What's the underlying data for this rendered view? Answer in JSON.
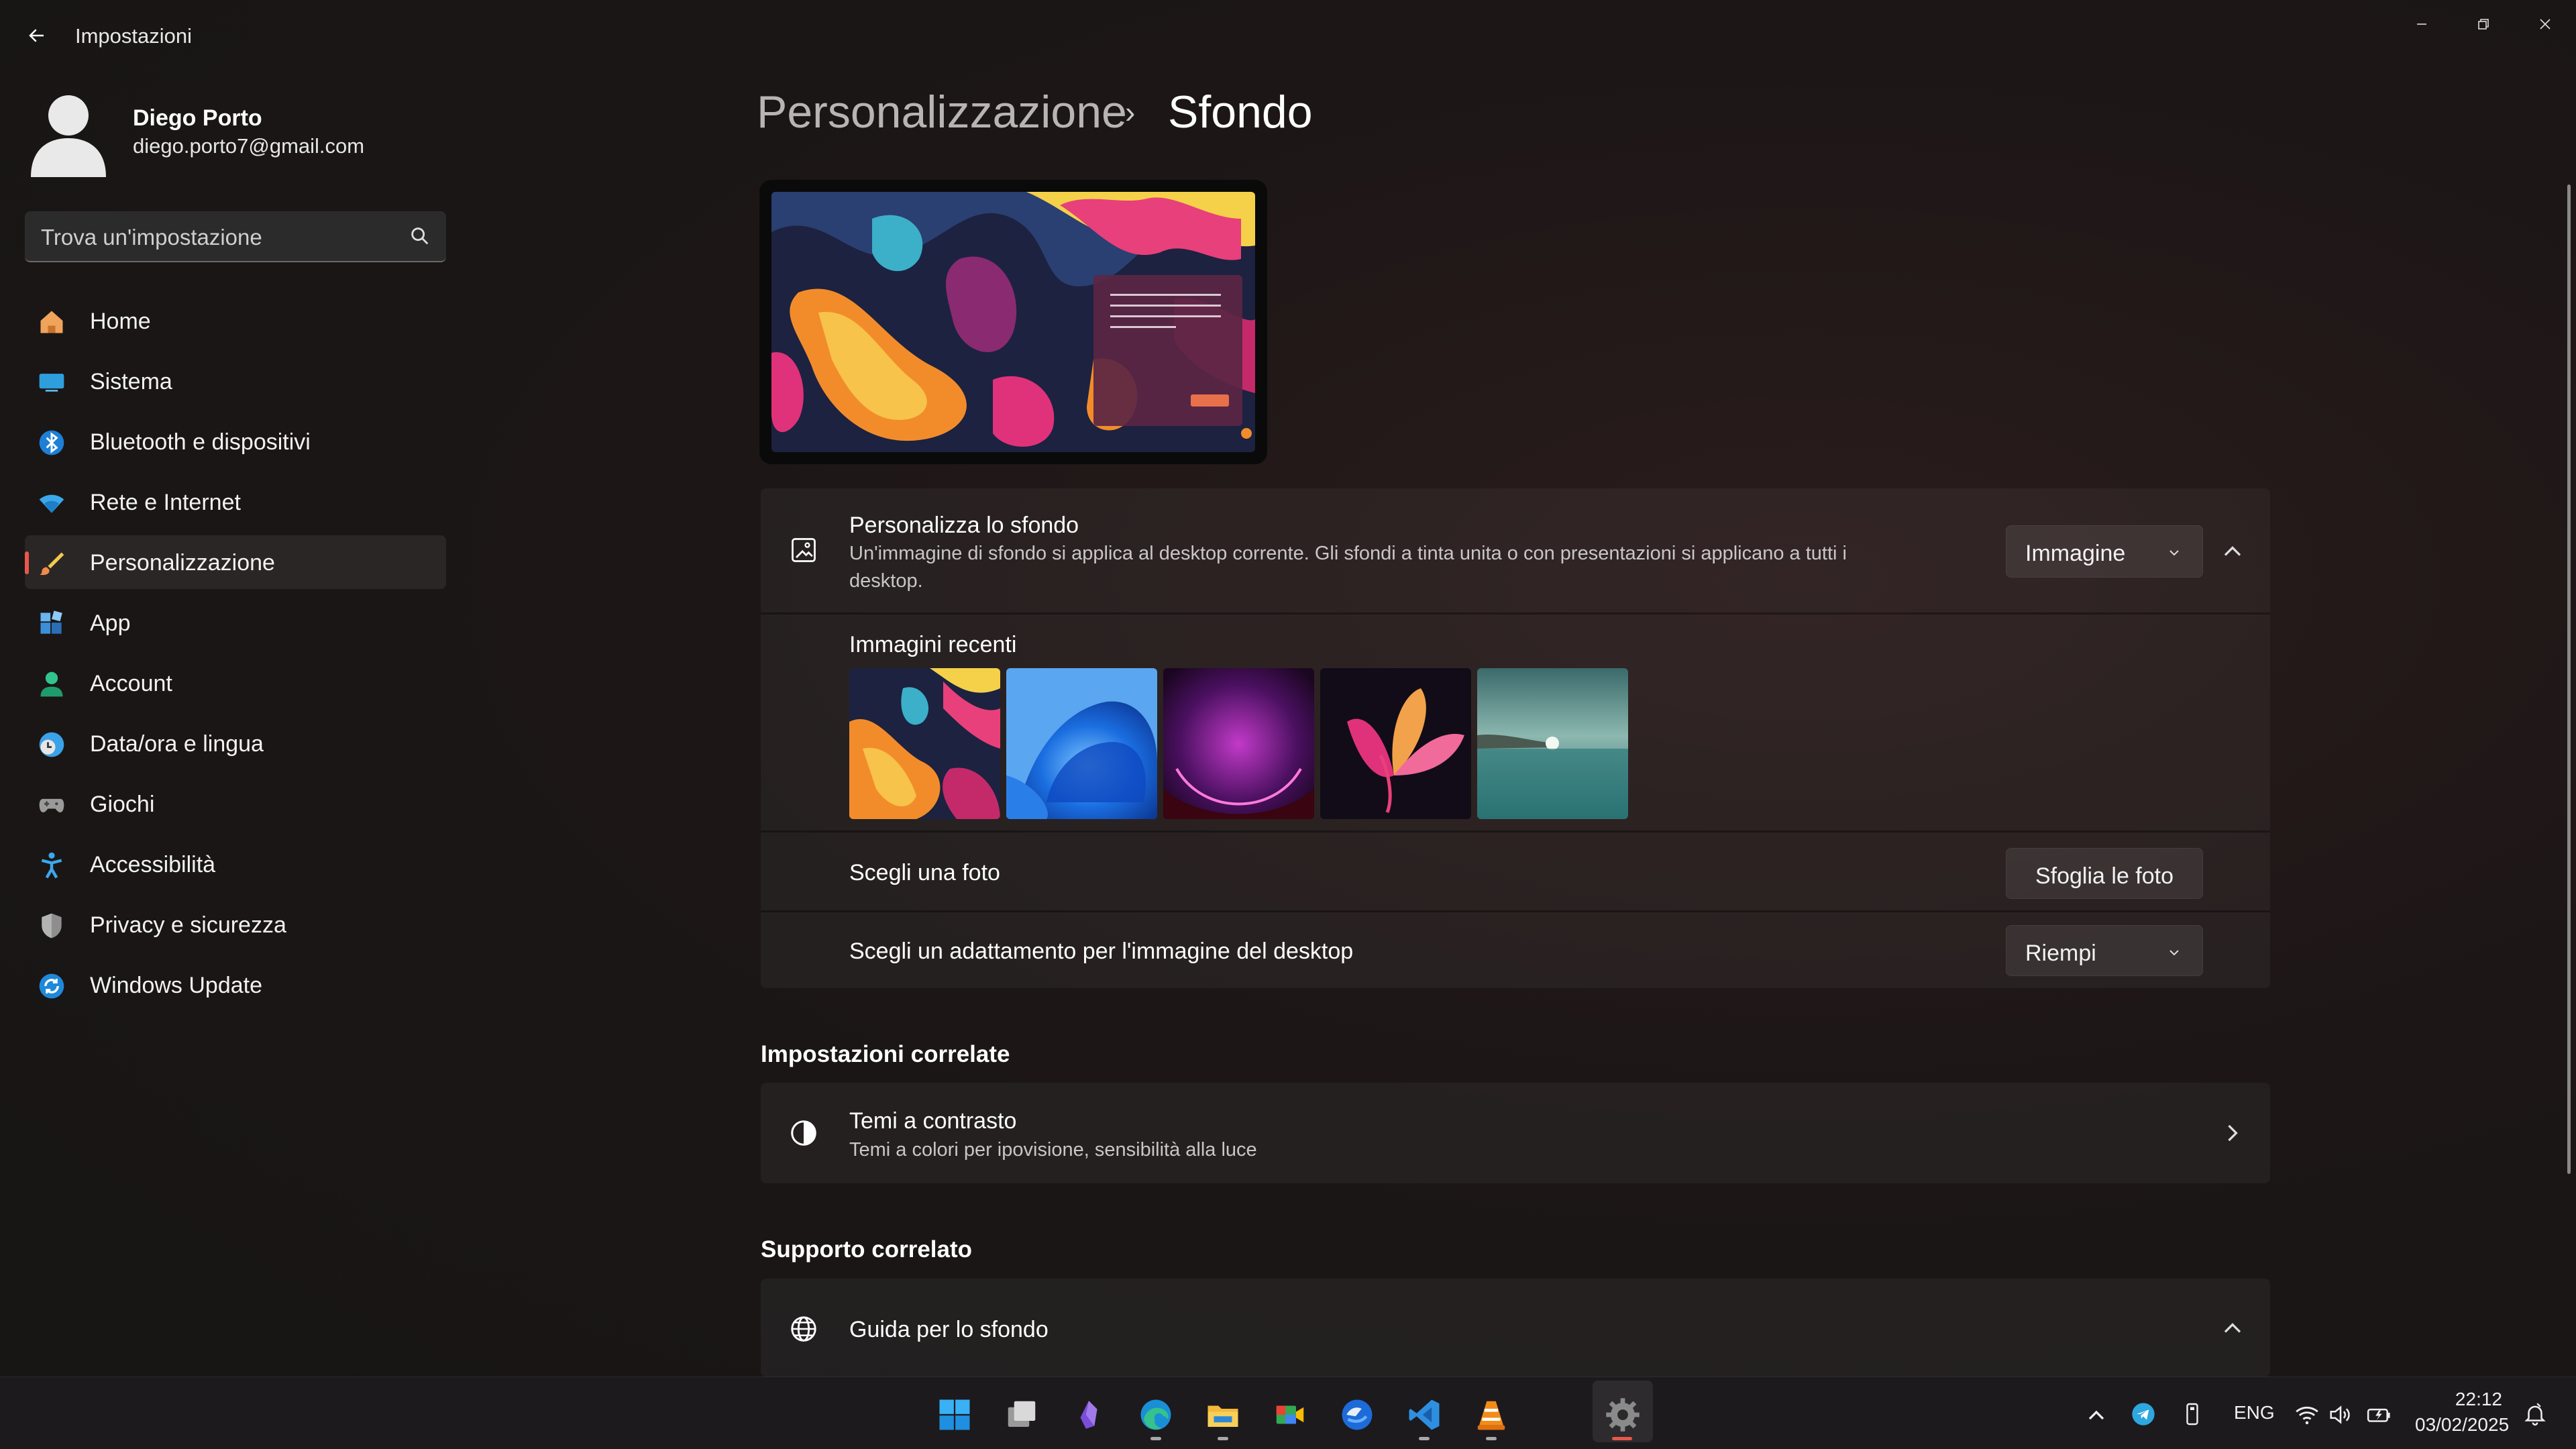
{
  "window": {
    "title": "Impostazioni",
    "controls": [
      "minimize-icon",
      "restore-icon",
      "close-icon"
    ]
  },
  "profile": {
    "name": "Diego Porto",
    "email": "diego.porto7@gmail.com"
  },
  "search": {
    "placeholder": "Trova un'impostazione"
  },
  "sidebar": {
    "items": [
      {
        "label": "Home",
        "icon": "home-icon"
      },
      {
        "label": "Sistema",
        "icon": "system-icon"
      },
      {
        "label": "Bluetooth e dispositivi",
        "icon": "bluetooth-icon"
      },
      {
        "label": "Rete e Internet",
        "icon": "wifi-icon"
      },
      {
        "label": "Personalizzazione",
        "icon": "brush-icon",
        "active": true
      },
      {
        "label": "App",
        "icon": "apps-icon"
      },
      {
        "label": "Account",
        "icon": "account-icon"
      },
      {
        "label": "Data/ora e lingua",
        "icon": "clock-globe-icon"
      },
      {
        "label": "Giochi",
        "icon": "gamepad-icon"
      },
      {
        "label": "Accessibilità",
        "icon": "accessibility-icon"
      },
      {
        "label": "Privacy e sicurezza",
        "icon": "shield-icon"
      },
      {
        "label": "Windows Update",
        "icon": "update-icon"
      }
    ]
  },
  "breadcrumb": {
    "parent": "Personalizzazione",
    "separator": "›",
    "current": "Sfondo"
  },
  "background": {
    "title": "Personalizza lo sfondo",
    "description_line1": "Un'immagine di sfondo si applica al desktop corrente. Gli sfondi a tinta unita o con presentazioni si applicano a tutti i",
    "description_line2": "desktop.",
    "type_value": "Immagine",
    "recent_label": "Immagini recenti",
    "choose_photo_label": "Scegli una foto",
    "browse_button": "Sfoglia le foto",
    "fit_label": "Scegli un adattamento per l'immagine del desktop",
    "fit_value": "Riempi"
  },
  "related_settings": {
    "heading": "Impostazioni correlate",
    "contrast_title": "Temi a contrasto",
    "contrast_desc": "Temi a colori per ipovisione, sensibilità alla luce"
  },
  "related_support": {
    "heading": "Supporto correlato",
    "guide_title": "Guida per lo sfondo"
  },
  "taskbar": {
    "apps": [
      "windows-start-icon",
      "task-view-icon",
      "obsidian-icon",
      "edge-icon",
      "file-explorer-icon",
      "meet-icon",
      "thunderbird-icon",
      "vscode-icon",
      "vlc-icon",
      "settings-icon"
    ],
    "tray": {
      "language": "ENG",
      "time": "22:12",
      "date": "03/02/2025"
    }
  },
  "colors": {
    "accent": "#e8584a",
    "card_bg": "#252222",
    "taskbar_bg": "#1c1a1d"
  }
}
